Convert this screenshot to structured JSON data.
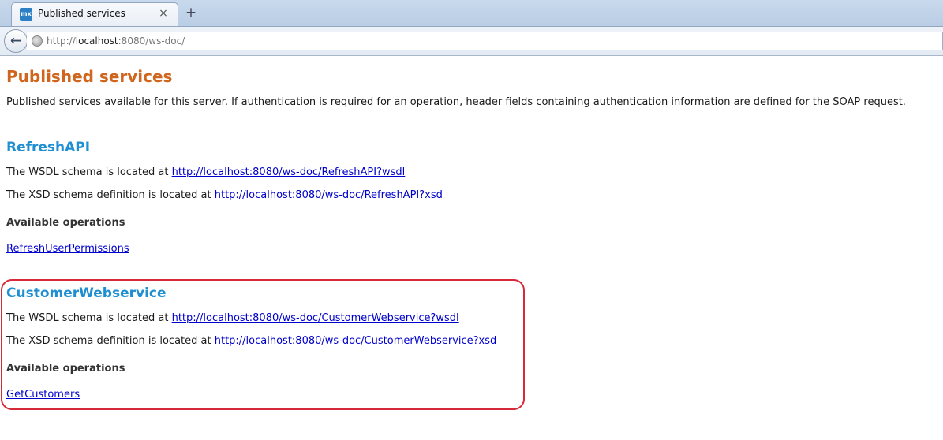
{
  "browser": {
    "tab_title": "Published services",
    "favicon_text": "mx",
    "close_glyph": "×",
    "newtab_glyph": "+",
    "back_glyph": "←",
    "url_prefix": "http://",
    "url_host": "localhost",
    "url_rest": ":8080/ws-doc/"
  },
  "page": {
    "title": "Published services",
    "intro": "Published services available for this server. If authentication is required for an operation, header fields containing authentication information are defined for the SOAP request."
  },
  "services": [
    {
      "name": "RefreshAPI",
      "wsdl_prefix": "The WSDL schema is located at ",
      "wsdl_url": "http://localhost:8080/ws-doc/RefreshAPI?wsdl",
      "xsd_prefix": "The XSD schema definition is located at ",
      "xsd_url": "http://localhost:8080/ws-doc/RefreshAPI?xsd",
      "ops_heading": "Available operations",
      "operations": [
        "RefreshUserPermissions"
      ]
    },
    {
      "name": "CustomerWebservice",
      "wsdl_prefix": "The WSDL schema is located at ",
      "wsdl_url": "http://localhost:8080/ws-doc/CustomerWebservice?wsdl",
      "xsd_prefix": "The XSD schema definition is located at ",
      "xsd_url": "http://localhost:8080/ws-doc/CustomerWebservice?xsd",
      "ops_heading": "Available operations",
      "operations": [
        "GetCustomers"
      ]
    }
  ],
  "colors": {
    "title": "#d0661d",
    "service_name": "#1f8fd1",
    "link": "#0000cc",
    "highlight_border": "#d62a3a"
  }
}
